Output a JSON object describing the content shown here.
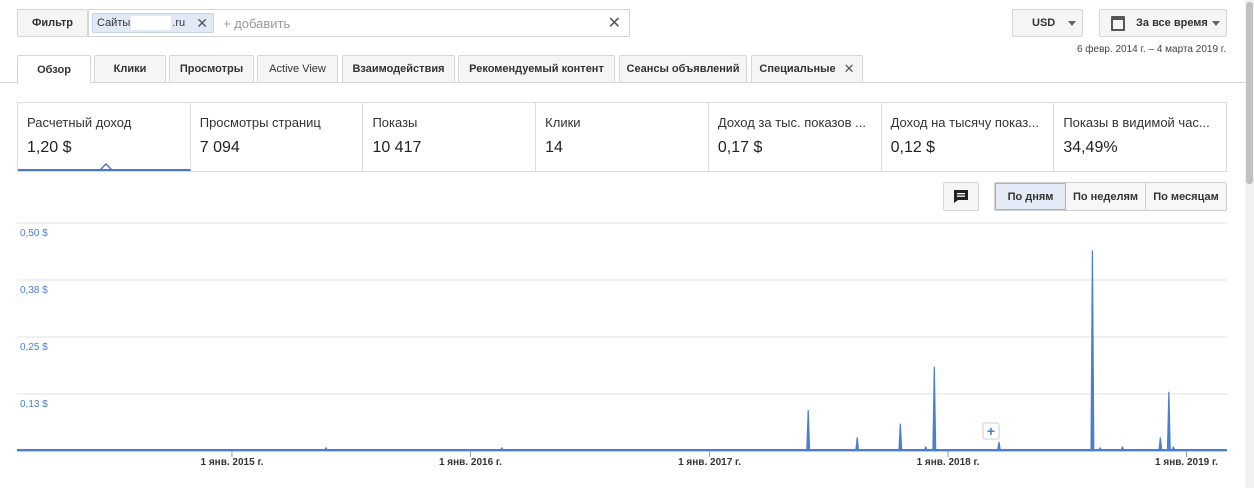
{
  "toolbar": {
    "filter_label": "Фильтр",
    "chip_prefix": "Сайты",
    "chip_suffix": ".ru",
    "add_placeholder": "+ добавить",
    "currency": "USD",
    "period": "За все время",
    "date_range": "6 февр. 2014 г. – 4 марта 2019 г."
  },
  "tabs": [
    {
      "label": "Обзор",
      "active": true
    },
    {
      "label": "Клики"
    },
    {
      "label": "Просмотры"
    },
    {
      "label": "Active View"
    },
    {
      "label": "Взаимодействия"
    },
    {
      "label": "Рекомендуемый контент"
    },
    {
      "label": "Сеансы объявлений"
    },
    {
      "label": "Специальные",
      "closable": true
    }
  ],
  "metrics": [
    {
      "name": "Расчетный доход",
      "value": "1,20 $"
    },
    {
      "name": "Просмотры страниц",
      "value": "7 094"
    },
    {
      "name": "Показы",
      "value": "10 417"
    },
    {
      "name": "Клики",
      "value": "14"
    },
    {
      "name": "Доход за тыс. показов ...",
      "value": "0,17 $"
    },
    {
      "name": "Доход на тысячу показ...",
      "value": "0,12 $"
    },
    {
      "name": "Показы в видимой час...",
      "value": "34,49%"
    }
  ],
  "granularity": {
    "day": "По дням",
    "week": "По неделям",
    "month": "По месяцам"
  },
  "colors": {
    "series": "#4a7fd0",
    "axis_label": "#4a7fd0"
  },
  "chart_data": {
    "type": "line",
    "y_ticks": [
      "0,13 $",
      "0,25 $",
      "0,38 $",
      "0,50 $"
    ],
    "ylim": [
      0,
      0.5
    ],
    "x_ticks": [
      "1 янв. 2015 г.",
      "1 янв. 2016 г.",
      "1 янв. 2017 г.",
      "1 янв. 2018 г.",
      "1 янв. 2019 г."
    ],
    "xlim": [
      "2014-02-06",
      "2019-03-04"
    ],
    "series": [
      {
        "x": [
          "2015-05-25",
          "2016-02-18",
          "2017-06-01",
          "2017-08-15",
          "2017-10-20",
          "2017-11-28",
          "2017-12-11",
          "2018-03-20",
          "2018-08-10",
          "2018-08-22",
          "2018-09-25",
          "2018-11-22",
          "2018-12-05",
          "2018-12-12"
        ],
        "y": [
          0.008,
          0.008,
          0.09,
          0.03,
          0.06,
          0.01,
          0.185,
          0.02,
          0.44,
          0.008,
          0.01,
          0.03,
          0.13,
          0.01
        ]
      }
    ]
  }
}
